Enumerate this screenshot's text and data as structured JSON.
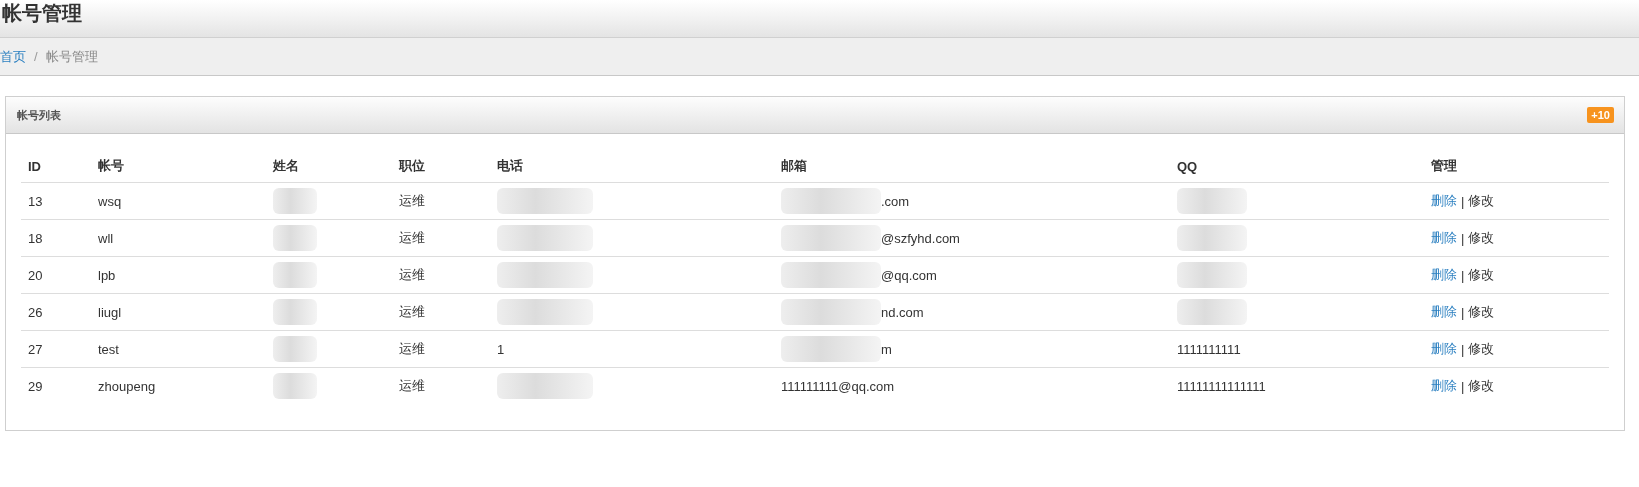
{
  "page_title": "帐号管理",
  "breadcrumb": [
    {
      "label": "首页",
      "kind": "link"
    },
    {
      "label": "/",
      "kind": "divider"
    },
    {
      "label": "帐号管理",
      "kind": "current"
    }
  ],
  "panel": {
    "title": "帐号列表",
    "badge": "+10",
    "table": {
      "columns": [
        "ID",
        "帐号",
        "姓名",
        "职位",
        "电话",
        "邮箱",
        "QQ",
        "管理"
      ],
      "rows": [
        {
          "id": "13",
          "account": "wsq",
          "name": {
            "redacted": true
          },
          "position": "运维",
          "phone": {
            "redacted": true
          },
          "email": {
            "text": ".com",
            "redacted": true
          },
          "qq": {
            "redacted": true
          },
          "separator": "|",
          "actions": [
            {
              "label": "删除",
              "kind": "delete"
            },
            {
              "label": "修改",
              "kind": "edit"
            }
          ]
        },
        {
          "id": "18",
          "account": "wll",
          "name": {
            "redacted": true
          },
          "position": "运维",
          "phone": {
            "redacted": true
          },
          "email": {
            "text": "@szfyhd.com",
            "redacted": true
          },
          "qq": {
            "redacted": true
          },
          "separator": "|",
          "actions": [
            {
              "label": "删除",
              "kind": "delete"
            },
            {
              "label": "修改",
              "kind": "edit"
            }
          ]
        },
        {
          "id": "20",
          "account": "lpb",
          "name": {
            "redacted": true
          },
          "position": "运维",
          "phone": {
            "redacted": true
          },
          "email": {
            "text": "@qq.com",
            "redacted": true
          },
          "qq": {
            "redacted": true
          },
          "separator": "|",
          "actions": [
            {
              "label": "删除",
              "kind": "delete"
            },
            {
              "label": "修改",
              "kind": "edit"
            }
          ]
        },
        {
          "id": "26",
          "account": "liugl",
          "name": {
            "redacted": true
          },
          "position": "运维",
          "phone": {
            "redacted": true
          },
          "email": {
            "text": "nd.com",
            "redacted": true
          },
          "qq": {
            "redacted": true
          },
          "separator": "|",
          "actions": [
            {
              "label": "删除",
              "kind": "delete"
            },
            {
              "label": "修改",
              "kind": "edit"
            }
          ]
        },
        {
          "id": "27",
          "account": "test",
          "name": {
            "redacted": true
          },
          "position": "运维",
          "phone": {
            "text": "1",
            "redacted": false
          },
          "email": {
            "text": "m",
            "redacted": true
          },
          "qq": {
            "text": "1111111111",
            "redacted": false
          },
          "separator": "|",
          "actions": [
            {
              "label": "删除",
              "kind": "delete"
            },
            {
              "label": "修改",
              "kind": "edit"
            }
          ]
        },
        {
          "id": "29",
          "account": "zhoupeng",
          "name": {
            "redacted": true
          },
          "position": "运维",
          "phone": {
            "redacted": true
          },
          "email": {
            "text": "111111111@qq.com",
            "redacted": false
          },
          "qq": {
            "text": "11111111111111",
            "redacted": false
          },
          "separator": "|",
          "actions": [
            {
              "label": "删除",
              "kind": "delete"
            },
            {
              "label": "修改",
              "kind": "edit"
            }
          ]
        }
      ]
    }
  }
}
